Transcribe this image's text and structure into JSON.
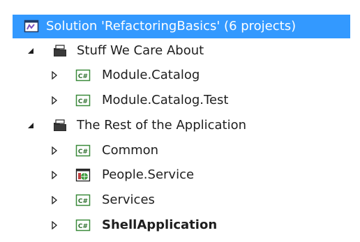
{
  "solution": {
    "label": "Solution 'RefactoringBasics' (6 projects)",
    "icon": "solution-icon",
    "selected": true
  },
  "folders": [
    {
      "label": "Stuff We Care About",
      "icon": "solution-folder-icon",
      "expanded": true,
      "projects": [
        {
          "label": "Module.Catalog",
          "icon": "csharp-project-icon",
          "bold": false
        },
        {
          "label": "Module.Catalog.Test",
          "icon": "csharp-project-icon",
          "bold": false
        }
      ]
    },
    {
      "label": "The Rest of the Application",
      "icon": "solution-folder-icon",
      "expanded": true,
      "projects": [
        {
          "label": "Common",
          "icon": "csharp-project-icon",
          "bold": false
        },
        {
          "label": "People.Service",
          "icon": "web-project-icon",
          "bold": false
        },
        {
          "label": "Services",
          "icon": "csharp-project-icon",
          "bold": false
        },
        {
          "label": "ShellApplication",
          "icon": "csharp-project-icon",
          "bold": true
        }
      ]
    }
  ],
  "colors": {
    "selection": "#3399ff",
    "csharp_icon": "#3a8a3a",
    "folder_icon": "#2b2b2b"
  }
}
